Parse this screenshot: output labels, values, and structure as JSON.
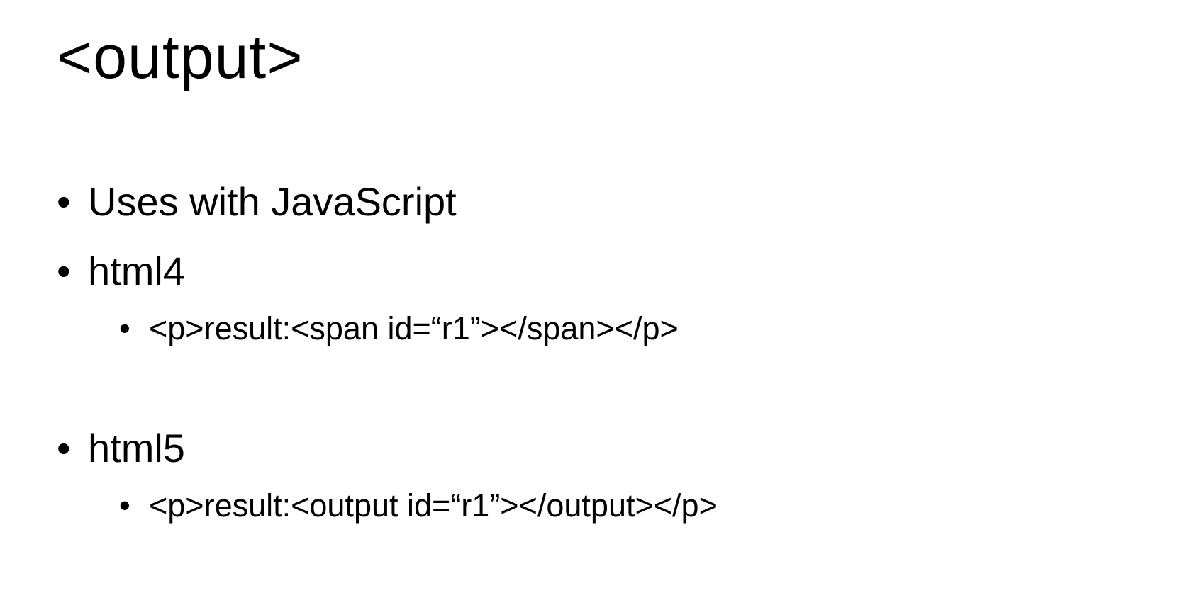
{
  "slide": {
    "title": "<output>",
    "bullet_symbol": "•",
    "items": [
      {
        "level": 1,
        "text": "Uses with JavaScript"
      },
      {
        "level": 1,
        "text": "html4"
      },
      {
        "level": 2,
        "text": "<p>result:<span id=“r1”></span></p>"
      },
      {
        "level": 1,
        "text": "html5"
      },
      {
        "level": 2,
        "text": "<p>result:<output id=“r1”></output></p>"
      }
    ]
  }
}
